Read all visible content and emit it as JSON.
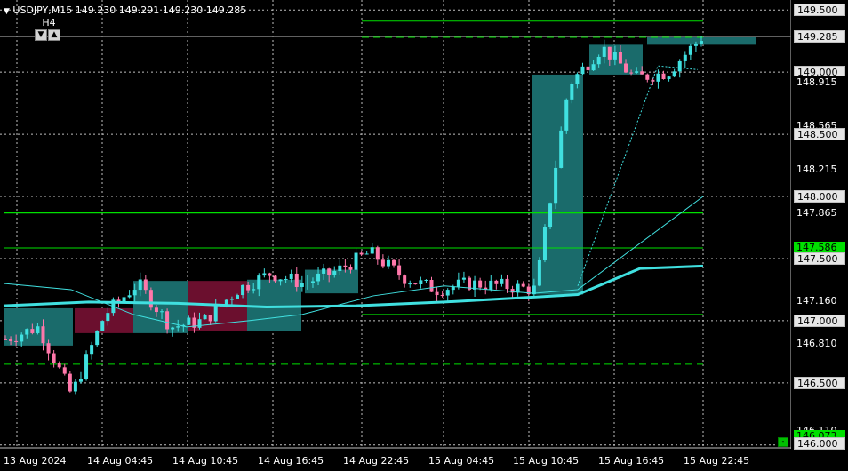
{
  "header": {
    "symbol": "USDJPY,M15",
    "ohlc": "149.230 149.291 149.230 149.285",
    "menu_icon": "triangle-down-icon"
  },
  "timeframe": {
    "label": "H4",
    "down_glyph": "▼",
    "up_glyph": "▲"
  },
  "price_axis": {
    "labels": [
      {
        "text": "149.500",
        "style": "boxed"
      },
      {
        "text": "149.285",
        "style": "boxed"
      },
      {
        "text": "149.000",
        "style": "boxed"
      },
      {
        "text": "148.915",
        "style": "plain"
      },
      {
        "text": "148.565",
        "style": "plain"
      },
      {
        "text": "148.500",
        "style": "boxed"
      },
      {
        "text": "148.215",
        "style": "plain"
      },
      {
        "text": "148.000",
        "style": "boxed"
      },
      {
        "text": "147.865",
        "style": "plain"
      },
      {
        "text": "147.586",
        "style": "green"
      },
      {
        "text": "147.500",
        "style": "boxed"
      },
      {
        "text": "147.160",
        "style": "plain"
      },
      {
        "text": "147.000",
        "style": "boxed"
      },
      {
        "text": "146.810",
        "style": "plain"
      },
      {
        "text": "146.500",
        "style": "boxed"
      },
      {
        "text": "146.110",
        "style": "plain"
      },
      {
        "text": "146.073",
        "style": "green"
      },
      {
        "text": "146.000",
        "style": "boxed"
      }
    ]
  },
  "time_axis": {
    "labels": [
      "13 Aug 2024",
      "14 Aug 04:45",
      "14 Aug 10:45",
      "14 Aug 16:45",
      "14 Aug 22:45",
      "15 Aug 04:45",
      "15 Aug 10:45",
      "15 Aug 16:45",
      "15 Aug 22:45"
    ]
  },
  "small_button": {
    "glyph": "-"
  },
  "colors": {
    "background": "#000000",
    "bull_candle": "#40e0e0",
    "bear_candle": "#ff77aa",
    "bull_box": "#1a6b6b",
    "bear_box": "#6b0f2e",
    "level_line": "#00e000",
    "ma_line": "#40e0e0"
  },
  "chart_data": {
    "type": "candlestick",
    "ylim": [
      145.97,
      149.58
    ],
    "grid": true,
    "levels": [
      149.41,
      149.28,
      147.87,
      147.586,
      147.05,
      146.65
    ],
    "h4_boxes": [
      {
        "open": 146.8,
        "close": 147.1
      },
      {
        "open": 147.1,
        "close": 146.9
      },
      {
        "open": 146.9,
        "close": 147.32
      },
      {
        "open": 147.32,
        "close": 146.92
      },
      {
        "open": 146.92,
        "close": 147.33
      },
      {
        "open": 147.22,
        "close": 147.41
      },
      {
        "open": 147.21,
        "close": 148.98
      },
      {
        "open": 148.98,
        "close": 149.22
      },
      {
        "open": 149.22,
        "close": 149.28
      }
    ],
    "ma_fast": [
      147.12,
      147.15,
      147.14,
      147.11,
      147.12,
      147.15,
      147.21,
      147.42,
      147.44
    ],
    "close_series": [
      146.85,
      146.95,
      146.4,
      147.05,
      147.3,
      146.95,
      147.0,
      147.25,
      147.38,
      147.3,
      147.4,
      147.55,
      147.35,
      147.25,
      147.3,
      147.28,
      147.25,
      148.9,
      149.2,
      148.95,
      149.0,
      149.28
    ]
  }
}
